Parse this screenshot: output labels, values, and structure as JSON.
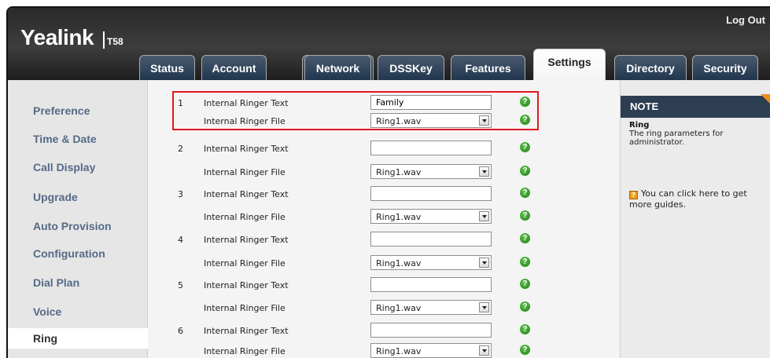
{
  "header": {
    "brand": "Yealink",
    "model": "T58",
    "logout": "Log Out"
  },
  "tabs": [
    {
      "label": "Status"
    },
    {
      "label": "Account"
    },
    {
      "label": "Network"
    },
    {
      "label": "DSSKey"
    },
    {
      "label": "Features"
    },
    {
      "label": "Settings",
      "active": true
    },
    {
      "label": "Directory"
    },
    {
      "label": "Security"
    }
  ],
  "sidebar": {
    "items": [
      {
        "label": "Preference"
      },
      {
        "label": "Time & Date"
      },
      {
        "label": "Call Display"
      },
      {
        "label": "Upgrade"
      },
      {
        "label": "Auto Provision"
      },
      {
        "label": "Configuration"
      },
      {
        "label": "Dial Plan"
      },
      {
        "label": "Voice"
      },
      {
        "label": "Ring",
        "active": true
      }
    ]
  },
  "ringers": [
    {
      "index": "1",
      "text_label": "Internal Ringer Text",
      "text_value": "Family",
      "file_label": "Internal Ringer File",
      "file_value": "Ring1.wav"
    },
    {
      "index": "2",
      "text_label": "Internal Ringer Text",
      "text_value": "",
      "file_label": "Internal Ringer File",
      "file_value": "Ring1.wav"
    },
    {
      "index": "3",
      "text_label": "Internal Ringer Text",
      "text_value": "",
      "file_label": "Internal Ringer File",
      "file_value": "Ring1.wav"
    },
    {
      "index": "4",
      "text_label": "Internal Ringer Text",
      "text_value": "",
      "file_label": "Internal Ringer File",
      "file_value": "Ring1.wav"
    },
    {
      "index": "5",
      "text_label": "Internal Ringer Text",
      "text_value": "",
      "file_label": "Internal Ringer File",
      "file_value": "Ring1.wav"
    },
    {
      "index": "6",
      "text_label": "Internal Ringer Text",
      "text_value": "",
      "file_label": "Internal Ringer File",
      "file_value": "Ring1.wav"
    }
  ],
  "help_glyph": "?",
  "note": {
    "heading": "NOTE",
    "title": "Ring",
    "body": "The ring parameters for administrator.",
    "guide_icon": "?",
    "guide_text": "You can click here to get more guides."
  },
  "colors": {
    "header_bg": "#2f2f2f",
    "tab_bg": "#2a3d55",
    "sidebar_link": "#556a86",
    "highlight_border": "#e0181f",
    "help_icon": "#3aa12a",
    "note_head": "#2d3e52",
    "note_corner": "#f08c1a"
  }
}
